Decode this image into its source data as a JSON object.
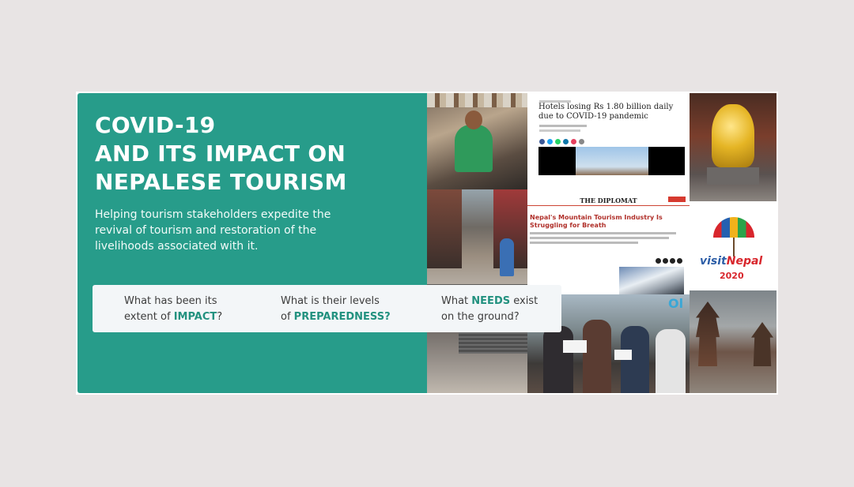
{
  "hero": {
    "title_lines": [
      "COVID-19",
      "AND ITS IMPACT ON",
      "NEPALESE TOURISM"
    ],
    "subtitle": "Helping tourism stakeholders expedite the revival of tourism and restoration of the livelihoods associated with it."
  },
  "questions": [
    {
      "line1": "What has been its",
      "prefix": "extent of ",
      "highlight": "IMPACT",
      "suffix": "?"
    },
    {
      "line1": "What is their levels",
      "prefix": "of ",
      "highlight": "PREPAREDNESS?",
      "suffix": ""
    },
    {
      "pre1": "What ",
      "highlight": "NEEDS",
      "post1": " exist",
      "line2": "on the ground?"
    }
  ],
  "collage": {
    "article1_headline": "Hotels losing Rs 1.80 billion daily due to COVID-19 pandemic",
    "article2_brand": "THE DIPLOMAT",
    "article2_headline": "Nepal's Mountain Tourism Industry Is Struggling for Breath",
    "logo_visit": "visit",
    "logo_nepal": "Nepal",
    "logo_year": "2020",
    "sign_fragment": "Ol"
  },
  "colors": {
    "teal": "#279c8a",
    "highlight": "#22917f",
    "background": "#e8e4e4"
  }
}
